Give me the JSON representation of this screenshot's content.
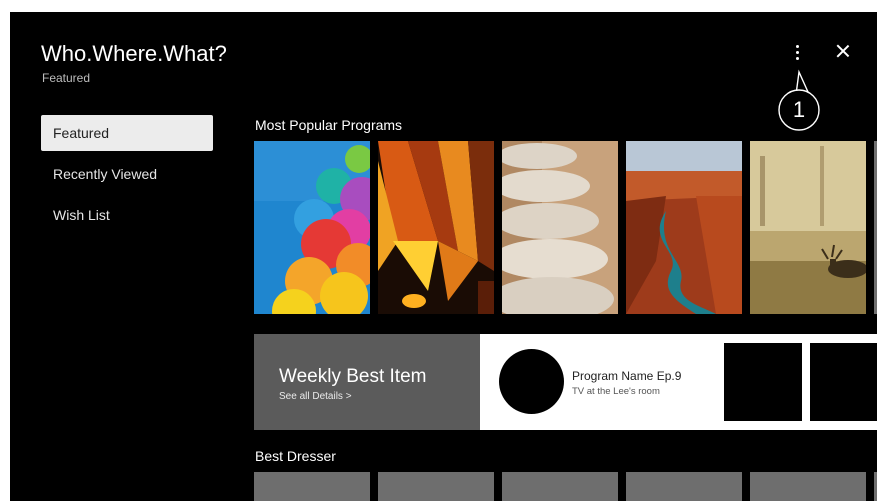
{
  "app": {
    "title": "Who.Where.What?",
    "subtitle": "Featured"
  },
  "nav": {
    "items": [
      {
        "label": "Featured",
        "active": true
      },
      {
        "label": "Recently Viewed",
        "active": false
      },
      {
        "label": "Wish List",
        "active": false
      }
    ]
  },
  "header": {
    "callout_number": "1",
    "more_icon": "more-vertical-icon",
    "close_icon": "close-icon"
  },
  "popular": {
    "title": "Most Popular Programs",
    "thumbnails": [
      "balloons",
      "hot-air-balloon",
      "stacked-stones",
      "canyon-river",
      "misty-field-elk"
    ]
  },
  "weekly": {
    "title": "Weekly Best Item",
    "link": "See all Details >",
    "program_name": "Program Name Ep.9",
    "program_desc": "TV at the Lee's room"
  },
  "dresser": {
    "title": "Best Dresser"
  }
}
